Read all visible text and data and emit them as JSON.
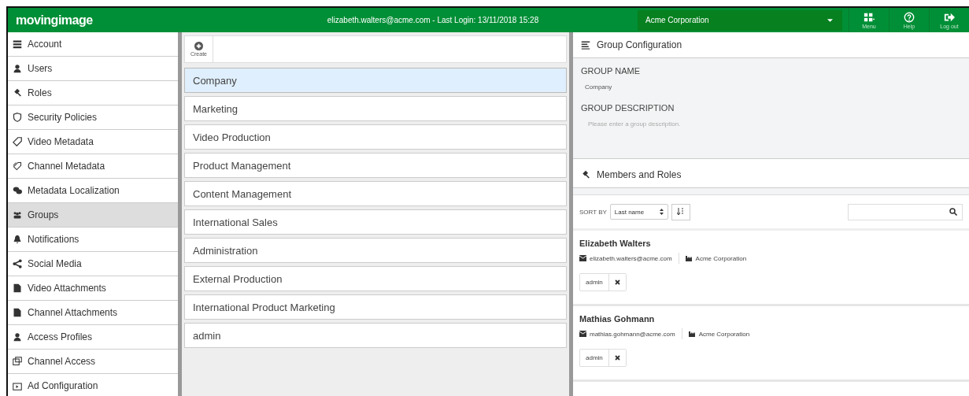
{
  "header": {
    "logo": "movingimage",
    "user_info": "elizabeth.walters@acme.com - Last Login: 13/11/2018 15:28",
    "company_select": "Acme Corporation",
    "buttons": [
      {
        "kind": "menu",
        "label": "Menu"
      },
      {
        "kind": "help",
        "label": "Help"
      },
      {
        "kind": "logout",
        "label": "Log out"
      }
    ]
  },
  "sidebar": {
    "items": [
      {
        "label": "Account",
        "kind": "account",
        "selected": false
      },
      {
        "label": "Users",
        "kind": "user",
        "selected": false
      },
      {
        "label": "Roles",
        "kind": "gavel",
        "selected": false
      },
      {
        "label": "Security Policies",
        "kind": "shield",
        "selected": false
      },
      {
        "label": "Video Metadata",
        "kind": "tag",
        "selected": false
      },
      {
        "label": "Channel Metadata",
        "kind": "tags",
        "selected": false
      },
      {
        "label": "Metadata Localization",
        "kind": "chat",
        "selected": false
      },
      {
        "label": "Groups",
        "kind": "group",
        "selected": true
      },
      {
        "label": "Notifications",
        "kind": "bell",
        "selected": false
      },
      {
        "label": "Social Media",
        "kind": "share",
        "selected": false
      },
      {
        "label": "Video Attachments",
        "kind": "file",
        "selected": false
      },
      {
        "label": "Channel Attachments",
        "kind": "file",
        "selected": false
      },
      {
        "label": "Access Profiles",
        "kind": "user",
        "selected": false
      },
      {
        "label": "Channel Access",
        "kind": "window",
        "selected": false
      },
      {
        "label": "Ad Configuration",
        "kind": "tv",
        "selected": false
      }
    ]
  },
  "groups": {
    "create_label": "Create",
    "items": [
      {
        "label": "Company",
        "selected": true
      },
      {
        "label": "Marketing",
        "selected": false
      },
      {
        "label": "Video Production",
        "selected": false
      },
      {
        "label": "Product Management",
        "selected": false
      },
      {
        "label": "Content Management",
        "selected": false
      },
      {
        "label": "International Sales",
        "selected": false
      },
      {
        "label": "Administration",
        "selected": false
      },
      {
        "label": "External Production",
        "selected": false
      },
      {
        "label": "International Product Marketing",
        "selected": false
      },
      {
        "label": "admin",
        "selected": false
      }
    ]
  },
  "configuration": {
    "title": "Group Configuration",
    "name_label": "GROUP NAME",
    "name_value": "Company",
    "description_label": "GROUP DESCRIPTION",
    "description_placeholder": "Please enter a group description."
  },
  "members": {
    "title": "Members and Roles",
    "sort_label": "SORT BY",
    "sort_value": "Last name",
    "list": [
      {
        "name": "Elizabeth Walters",
        "email": "elizabeth.walters@acme.com",
        "company": "Acme Corporation",
        "role": "admin"
      },
      {
        "name": "Mathias Gohmann",
        "email": "mathias.gohmann@acme.com",
        "company": "Acme Corporation",
        "role": "admin"
      }
    ]
  }
}
